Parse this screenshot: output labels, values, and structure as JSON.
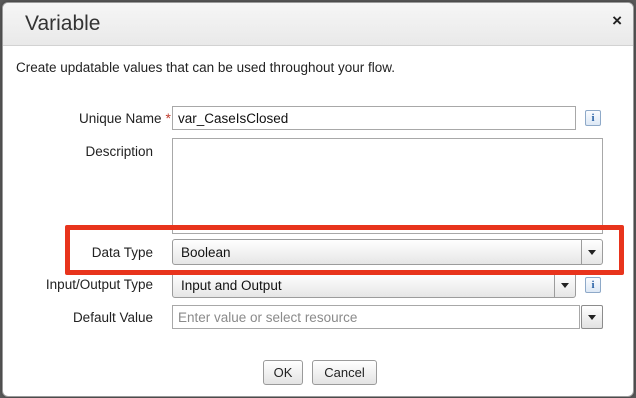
{
  "dialog": {
    "title": "Variable",
    "close_glyph": "×",
    "intro": "Create updatable values that can be used throughout your flow."
  },
  "fields": {
    "unique_name": {
      "label": "Unique Name",
      "required_marker": "*",
      "value": "var_CaseIsClosed",
      "info_icon": "i"
    },
    "description": {
      "label": "Description",
      "value": ""
    },
    "data_type": {
      "label": "Data Type",
      "selected": "Boolean"
    },
    "io_type": {
      "label": "Input/Output Type",
      "selected": "Input and Output",
      "info_icon": "i"
    },
    "default_value": {
      "label": "Default Value",
      "placeholder": "Enter value or select resource",
      "value": ""
    }
  },
  "buttons": {
    "ok": "OK",
    "cancel": "Cancel"
  },
  "colors": {
    "highlight": "#e8341c",
    "required": "#c0392b",
    "info": "#2a62a6"
  }
}
